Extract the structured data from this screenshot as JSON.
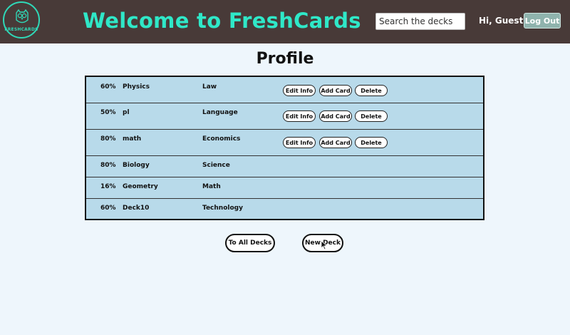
{
  "header": {
    "logo_text": "FRESHCARDS",
    "title": "Welcome to FreshCards",
    "search_placeholder": "Search the decks",
    "greeting": "Hi, Guest",
    "logout_label": "Log Out"
  },
  "page": {
    "title": "Profile"
  },
  "decks": [
    {
      "percent": "60%",
      "name": "Physics",
      "category": "Law"
    },
    {
      "percent": "50%",
      "name": "pl",
      "category": "Language"
    },
    {
      "percent": "80%",
      "name": "math",
      "category": "Economics"
    },
    {
      "percent": "80%",
      "name": "Biology",
      "category": "Science"
    },
    {
      "percent": "16%",
      "name": "Geometry",
      "category": "Math"
    },
    {
      "percent": "60%",
      "name": "Deck10",
      "category": "Technology"
    }
  ],
  "row_actions": {
    "edit_label": "Edit Info",
    "add_label": "Add Card",
    "delete_label": "Delete"
  },
  "footer_buttons": {
    "all_decks_label": "To All Decks",
    "new_deck_label": "New Deck"
  },
  "colors": {
    "header_bg": "#483a38",
    "accent": "#2fe8c8",
    "page_bg": "#eef6fc",
    "table_bg": "#b8daea",
    "logout_bg": "#8fb3ad"
  },
  "icons": {
    "logo": "owl-logo-icon",
    "cursor": "mouse-cursor-icon"
  }
}
